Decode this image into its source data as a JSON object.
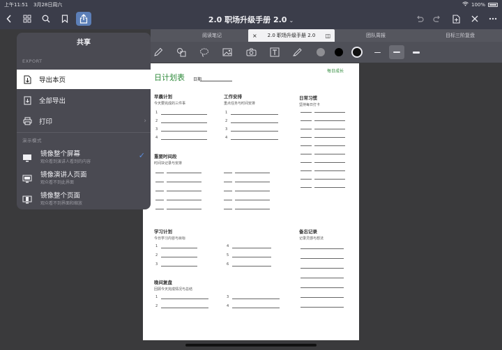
{
  "status_bar": {
    "time": "上午11:51",
    "date": "3月28日周六",
    "battery": "100%"
  },
  "nav": {
    "title": "2.0 职场升级手册 2.0",
    "caret": "⌄",
    "icons": [
      "chevron-left-icon",
      "grid-icon",
      "search-icon",
      "bookmark-icon",
      "share-icon",
      "undo-icon",
      "redo-icon",
      "new-page-icon",
      "close-icon",
      "more-icon"
    ]
  },
  "tabs": [
    {
      "label": "阅读笔记",
      "active": false
    },
    {
      "label": "2.0 职场升级手册 2.0",
      "active": true,
      "close": "×",
      "split": "◫"
    },
    {
      "label": "团队周报",
      "active": false
    },
    {
      "label": "目标三阶复盘",
      "active": false
    }
  ],
  "toolbar": {
    "colors": [
      "#8e8e93",
      "#000000",
      "#111111"
    ]
  },
  "share": {
    "title": "共享",
    "export_header": "EXPORT",
    "export_page": "导出本页",
    "export_all": "全部导出",
    "print": "打印",
    "print_chevron": "›",
    "present_header": "演示模式",
    "mirror_screen": "镜像整个屏幕",
    "mirror_screen_desc": "观众看到演讲人看到的内容",
    "mirror_speaker": "镜像演讲人页面",
    "mirror_speaker_desc": "观众看不到此界面",
    "mirror_page": "镜像整个页面",
    "mirror_page_desc": "观众看不到界面和缩放",
    "checkmark": "✓"
  },
  "paper": {
    "title": "日计划表",
    "date_label": "日期",
    "motto": "每日成长",
    "sections": {
      "morning": {
        "title": "早晨计划",
        "sub": "今天要完成的三件事"
      },
      "work": {
        "title": "工作安排",
        "sub": "重点任务与时间安排"
      },
      "routine": {
        "title": "日常习惯",
        "sub": "坚持每日打卡"
      },
      "schedule": {
        "title": "重要时间段",
        "sub": "时间块记录与安排"
      },
      "study": {
        "title": "学习计划",
        "sub": "今日学习内容与目标"
      },
      "notes": {
        "title": "备忘记录",
        "sub": "记录灵感与想法"
      },
      "review": {
        "title": "晚间复盘",
        "sub": "回顾今天完成情况与总结"
      }
    }
  }
}
